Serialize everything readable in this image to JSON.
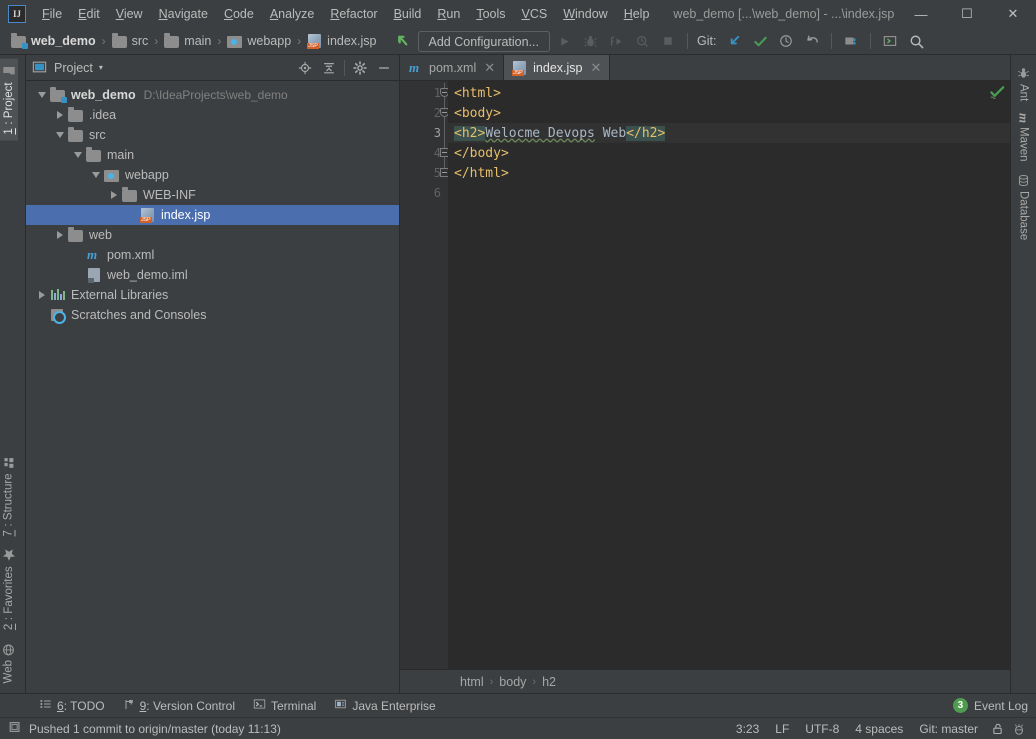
{
  "window": {
    "title": "web_demo [...\\web_demo] - ...\\index.jsp",
    "minimize": "—",
    "maximize": "☐",
    "close": "✕",
    "logo": "IJ"
  },
  "menu": {
    "items": [
      {
        "pre": "",
        "mnemonic": "F",
        "post": "ile"
      },
      {
        "pre": "",
        "mnemonic": "E",
        "post": "dit"
      },
      {
        "pre": "",
        "mnemonic": "V",
        "post": "iew"
      },
      {
        "pre": "",
        "mnemonic": "N",
        "post": "avigate"
      },
      {
        "pre": "",
        "mnemonic": "C",
        "post": "ode"
      },
      {
        "pre": "",
        "mnemonic": "A",
        "post": "nalyze"
      },
      {
        "pre": "",
        "mnemonic": "R",
        "post": "efactor"
      },
      {
        "pre": "",
        "mnemonic": "B",
        "post": "uild"
      },
      {
        "pre": "",
        "mnemonic": "R",
        "post": "un"
      },
      {
        "pre": "",
        "mnemonic": "T",
        "post": "ools"
      },
      {
        "pre": "",
        "mnemonic": "V",
        "post": "CS"
      },
      {
        "pre": "",
        "mnemonic": "W",
        "post": "indow"
      },
      {
        "pre": "",
        "mnemonic": "H",
        "post": "elp"
      }
    ]
  },
  "navbar": {
    "crumbs": [
      {
        "label": "web_demo",
        "icon": "module-icon",
        "root": true
      },
      {
        "label": "src",
        "icon": "folder-icon",
        "root": false
      },
      {
        "label": "main",
        "icon": "folder-icon",
        "root": false
      },
      {
        "label": "webapp",
        "icon": "web-folder-icon",
        "root": false
      },
      {
        "label": "index.jsp",
        "icon": "jsp-file-icon",
        "root": false
      }
    ],
    "separator": "›",
    "project_path": "D:\\IdeaProjects\\web_demo"
  },
  "toolbar": {
    "add_configuration": "Add Configuration...",
    "git_label": "Git:",
    "icons": [
      "back-arrow-icon",
      "run-icon",
      "debug-icon",
      "run-with-coverage-icon",
      "profile-icon",
      "stop-icon",
      "update-project-icon",
      "commit-icon",
      "history-icon",
      "rollback-icon",
      "project-structure-icon",
      "terminal-icon",
      "search-everywhere-icon"
    ]
  },
  "left_strip": {
    "top": [
      {
        "num": "1",
        "label": ": Project",
        "active": true,
        "icon": "project-folder-icon"
      }
    ],
    "bottom": [
      {
        "num": "7",
        "label": ": Structure",
        "active": false,
        "icon": "structure-icon"
      },
      {
        "num": "2",
        "label": ": Favorites",
        "active": false,
        "icon": "star-icon"
      },
      {
        "num": "",
        "label": "Web",
        "active": false,
        "icon": "web-icon"
      }
    ]
  },
  "right_strip": {
    "items": [
      {
        "label": "Ant",
        "icon": "ant-icon"
      },
      {
        "label": "Maven",
        "icon": "maven-icon"
      },
      {
        "label": "Database",
        "icon": "database-icon"
      }
    ]
  },
  "project_panel": {
    "title": "Project",
    "caret": "▾",
    "head_icons": [
      "locate-icon",
      "collapse-all-icon",
      "settings-gear-icon",
      "hide-icon"
    ],
    "tree": [
      {
        "depth": 0,
        "arrow": "open",
        "icon": "module-icon",
        "label": "web_demo",
        "bold": true,
        "path": "D:\\IdeaProjects\\web_demo",
        "selected": false
      },
      {
        "depth": 1,
        "arrow": "closed",
        "icon": "folder-icon",
        "label": ".idea",
        "bold": false,
        "path": "",
        "selected": false
      },
      {
        "depth": 1,
        "arrow": "open",
        "icon": "folder-icon",
        "label": "src",
        "bold": false,
        "path": "",
        "selected": false
      },
      {
        "depth": 2,
        "arrow": "open",
        "icon": "folder-icon",
        "label": "main",
        "bold": false,
        "path": "",
        "selected": false
      },
      {
        "depth": 3,
        "arrow": "open",
        "icon": "web-folder-icon",
        "label": "webapp",
        "bold": false,
        "path": "",
        "selected": false
      },
      {
        "depth": 4,
        "arrow": "closed",
        "icon": "folder-icon",
        "label": "WEB-INF",
        "bold": false,
        "path": "",
        "selected": false
      },
      {
        "depth": 5,
        "arrow": "none",
        "icon": "jsp-file-icon",
        "label": "index.jsp",
        "bold": false,
        "path": "",
        "selected": true
      },
      {
        "depth": 1,
        "arrow": "closed",
        "icon": "folder-icon",
        "label": "web",
        "bold": false,
        "path": "",
        "selected": false
      },
      {
        "depth": 2,
        "arrow": "none",
        "icon": "maven-pom-icon",
        "label": "pom.xml",
        "bold": false,
        "path": "",
        "selected": false
      },
      {
        "depth": 2,
        "arrow": "none",
        "icon": "iml-file-icon",
        "label": "web_demo.iml",
        "bold": false,
        "path": "",
        "selected": false
      },
      {
        "depth": 0,
        "arrow": "closed",
        "icon": "libraries-icon",
        "label": "External Libraries",
        "bold": false,
        "path": "",
        "selected": false
      },
      {
        "depth": 0,
        "arrow": "none",
        "icon": "scratches-icon",
        "label": "Scratches and Consoles",
        "bold": false,
        "path": "",
        "selected": false
      }
    ]
  },
  "editor": {
    "tabs": [
      {
        "label": "pom.xml",
        "icon": "maven-pom-icon",
        "active": false,
        "close": "✕"
      },
      {
        "label": "index.jsp",
        "icon": "jsp-file-icon",
        "active": true,
        "close": "✕"
      }
    ],
    "line_numbers": [
      "1",
      "2",
      "3",
      "4",
      "5",
      "6"
    ],
    "current_line": 3,
    "lines": [
      {
        "num": 1,
        "segments": [
          {
            "text": "<html>",
            "style": "tag"
          }
        ]
      },
      {
        "num": 2,
        "segments": [
          {
            "text": "<body>",
            "style": "tag"
          }
        ]
      },
      {
        "num": 3,
        "segments": [
          {
            "text": "<h2>",
            "style": "tag-highlight"
          },
          {
            "text": "Welocme Devops",
            "style": "spell"
          },
          {
            "text": " Web",
            "style": "plain"
          },
          {
            "text": "</h2>",
            "style": "tag-highlight"
          }
        ]
      },
      {
        "num": 4,
        "segments": [
          {
            "text": "</body>",
            "style": "tag"
          }
        ]
      },
      {
        "num": 5,
        "segments": [
          {
            "text": "</html>",
            "style": "tag"
          }
        ]
      },
      {
        "num": 6,
        "segments": []
      }
    ],
    "breadcrumb": [
      "html",
      "body",
      "h2"
    ],
    "breadcrumb_sep": "›",
    "inspection": "ok-with-warnings"
  },
  "bottom_bar": {
    "tools": [
      {
        "num": "6",
        "label": ": TODO",
        "icon": "todo-icon"
      },
      {
        "num": "9",
        "label": ": Version Control",
        "icon": "vcs-branch-icon"
      },
      {
        "num": "",
        "label": "Terminal",
        "icon": "terminal-icon"
      },
      {
        "num": "",
        "label": "Java Enterprise",
        "icon": "java-enterprise-icon"
      }
    ],
    "event_log": {
      "count": "3",
      "label": "Event Log"
    }
  },
  "status_bar": {
    "message": "Pushed 1 commit to origin/master (today 11:13)",
    "caret_position": "3:23",
    "line_separator": "LF",
    "encoding": "UTF-8",
    "indent": "4 spaces",
    "branch": "Git: master",
    "icons": [
      "lock-icon",
      "inspector-icon"
    ]
  },
  "colors": {
    "bg_chrome": "#3c3f41",
    "bg_editor": "#2b2b2b",
    "selection_blue": "#4b6eaf",
    "tag_orange": "#e8bf6a",
    "text_main": "#bbbbbb",
    "spell_green": "#6a8759",
    "brace_highlight": "#3b514d",
    "badge_green": "#4f9b4f"
  }
}
